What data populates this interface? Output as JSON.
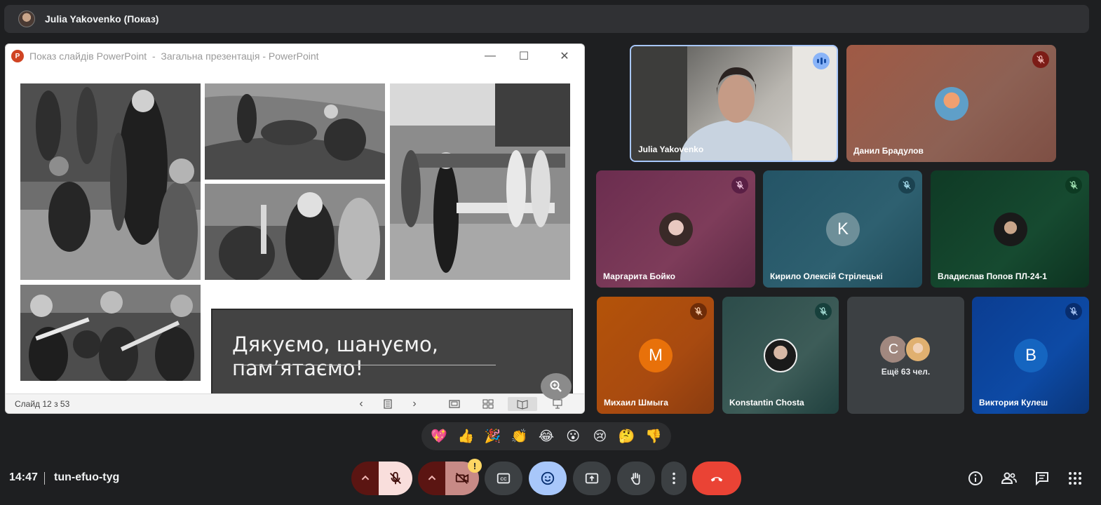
{
  "top_bar": {
    "presenter_name": "Julia Yakovenko (Показ)"
  },
  "powerpoint": {
    "window_title": "Показ слайдів PowerPoint  -  Загальна презентація - PowerPoint",
    "app_icon_letter": "P",
    "slide_caption": "Дякуємо, шануємо, пам’ятаємо!",
    "status": {
      "slide_counter": "Слайд 12 з 53"
    }
  },
  "participants": [
    {
      "name": "Julia Yakovenko",
      "status": "speaking",
      "video": true
    },
    {
      "name": "Данил Брадулов",
      "status": "muted"
    },
    {
      "name": "Маргарита Бойко",
      "status": "muted"
    },
    {
      "name": "Кирило Олексій Стрілецькі",
      "status": "muted",
      "initial": "K"
    },
    {
      "name": "Владислав Попов ПЛ-24-1",
      "status": "muted"
    },
    {
      "name": "Михаил Шмыга",
      "status": "muted",
      "initial": "M"
    },
    {
      "name": "Konstantin Chosta",
      "status": "muted"
    },
    {
      "name": "Ещё 63 чел.",
      "initial": "C"
    },
    {
      "name": "Виктория Кулеш",
      "status": "muted",
      "initial": "B"
    }
  ],
  "reactions": [
    "💖",
    "👍",
    "🎉",
    "👏",
    "😂",
    "😮",
    "😢",
    "🤔",
    "👎"
  ],
  "bottom_bar": {
    "time": "14:47",
    "meeting_code": "tun-efuo-tyg",
    "camera_warning_badge": "!"
  },
  "colors": {
    "background": "#1e1f21",
    "end_call": "#ea4335",
    "muted_control": "#f9dedc",
    "emoji_active": "#a8c7fa",
    "speaking_border": "#a8c7fa"
  }
}
